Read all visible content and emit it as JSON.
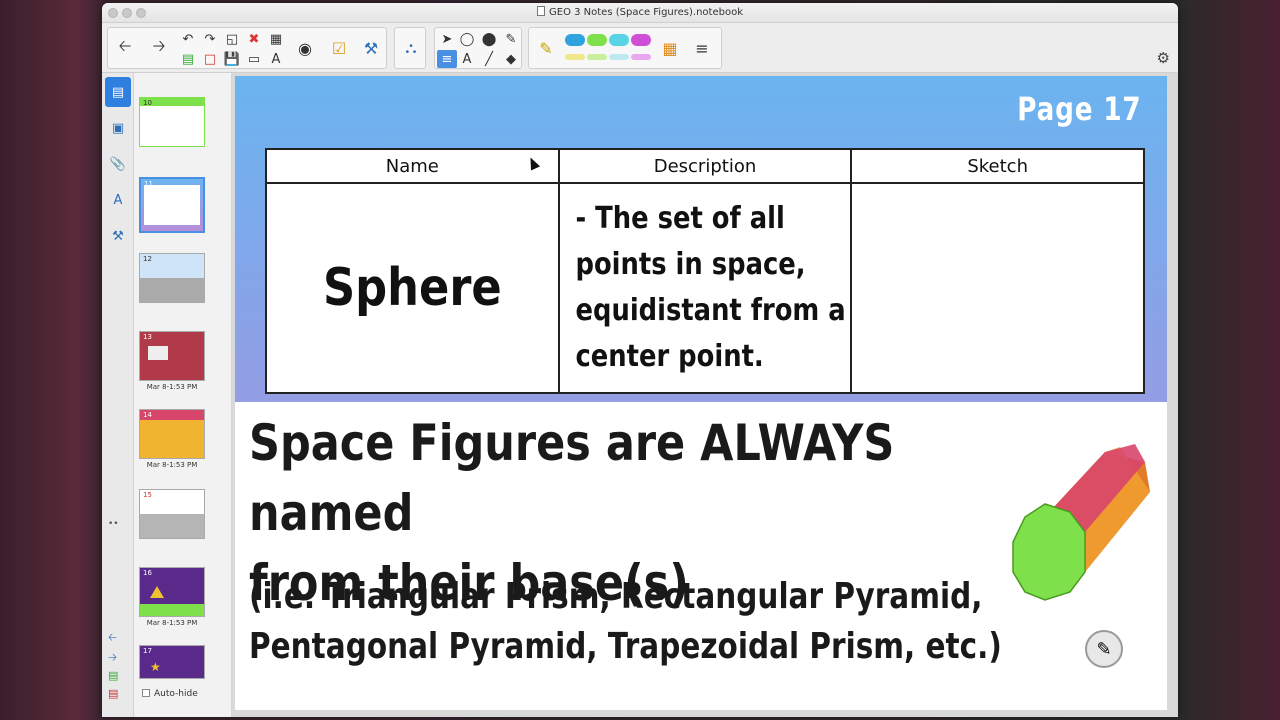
{
  "window": {
    "title": "GEO 3 Notes (Space Figures).notebook"
  },
  "toolbar": {
    "buttons": [
      "back-icon",
      "forward-icon",
      "undo-icon",
      "redo-icon",
      "new-page-icon",
      "delete-icon",
      "table-icon",
      "screen-shade-icon",
      "doc-camera-icon",
      "response-icon",
      "addons-icon",
      "select-icon",
      "shapes-icon",
      "fill-icon",
      "eraser-icon",
      "text-icon",
      "line-icon",
      "pen-icon"
    ],
    "pen_colors": [
      "#2fa3e0",
      "#7ee04a",
      "#59d4e6",
      "#cf4fd6"
    ],
    "settings_icon": "gear-icon"
  },
  "sidebar": {
    "tabs": [
      "page-sorter-icon",
      "gallery-icon",
      "attachments-icon",
      "properties-icon",
      "addons-icon"
    ],
    "thumbnails": [
      {
        "num": "10",
        "date": ""
      },
      {
        "num": "11",
        "date": ""
      },
      {
        "num": "12",
        "date": ""
      },
      {
        "num": "13",
        "date": "Mar 8-1:53 PM"
      },
      {
        "num": "14",
        "date": "Mar 8-1:53 PM"
      },
      {
        "num": "15",
        "date": ""
      },
      {
        "num": "16",
        "date": "Mar 8-1:53 PM"
      },
      {
        "num": "17",
        "date": ""
      }
    ],
    "autohide_label": "Auto-hide"
  },
  "page": {
    "page_label": "Page 17",
    "table": {
      "headers": [
        "Name",
        "Description",
        "Sketch"
      ],
      "row": {
        "name": "Sphere",
        "description_lines": [
          "- The set of all",
          "points in space,",
          "equidistant from a",
          "center point."
        ],
        "sketch": ""
      }
    },
    "overlay": {
      "main_lines": [
        "Space Figures are ALWAYS named",
        "from their base(s)"
      ],
      "sub_lines": [
        "(i.e. Triangular Prism, Rectangular Pyramid,",
        "Pentagonal Pyramid, Trapezoidal Prism, etc.)"
      ]
    }
  },
  "colors": {
    "page_gradient_top": "#6ab4f0",
    "page_gradient_bottom": "#b58fd8",
    "prism_side": "#7ee04a",
    "prism_top": "#d8456b",
    "prism_right": "#f08a2a"
  }
}
